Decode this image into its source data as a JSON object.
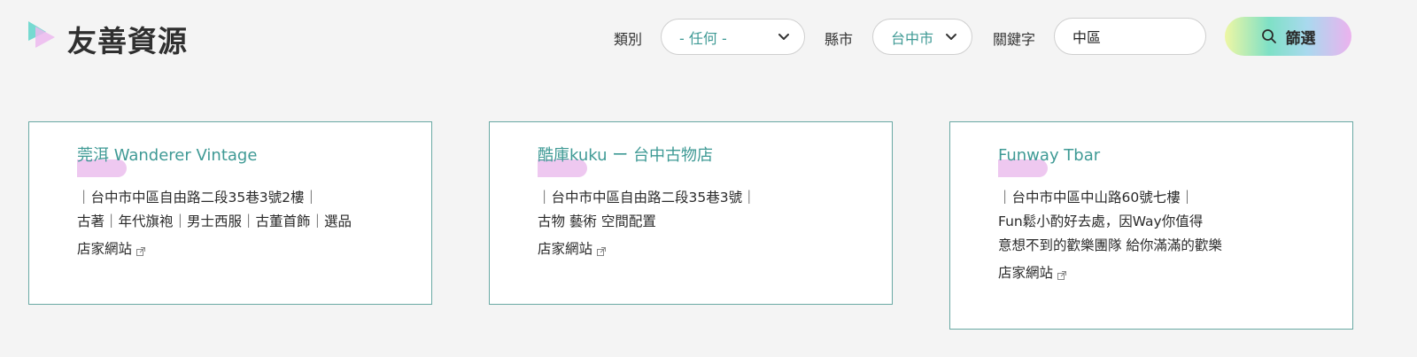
{
  "header": {
    "title": "友善資源",
    "logo_icon": "play-triangle-logo-icon"
  },
  "filters": {
    "category_label": "類別",
    "category_value": "- 任何 -",
    "county_label": "縣市",
    "county_value": "台中市",
    "keyword_label": "關鍵字",
    "keyword_value": "中區",
    "button_label": "篩選",
    "button_icon": "search-icon"
  },
  "cards": [
    {
      "title": "莞洱 Wanderer Vintage",
      "lines": [
        "｜台中市中區自由路二段35巷3號2樓｜",
        "古著｜年代旗袍｜男士西服｜古董首飾｜選品"
      ],
      "link_label": "店家網站"
    },
    {
      "title": "酷庫kuku ー 台中古物店",
      "lines": [
        "｜台中市中區自由路二段35巷3號｜",
        "古物 藝術 空間配置"
      ],
      "link_label": "店家網站"
    },
    {
      "title": "Funway Tbar",
      "lines": [
        "｜台中市中區中山路60號七樓｜",
        "Fun鬆小酌好去處，因Way你值得",
        "意想不到的歡樂團隊 給你滿滿的歡樂"
      ],
      "link_label": "店家網站"
    }
  ],
  "colors": {
    "accent": "#3f9a95",
    "card_border": "#6aa9a4",
    "highlight": "#eec8f0",
    "background": "#f4f4f4"
  }
}
